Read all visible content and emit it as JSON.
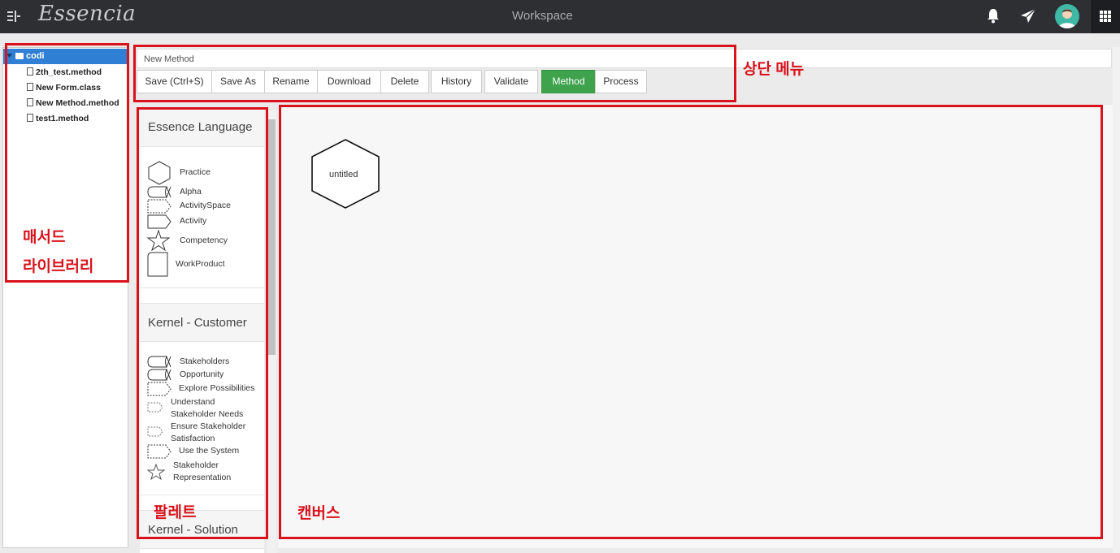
{
  "header": {
    "brand": "Essencia",
    "title": "Workspace",
    "icons": [
      "menu-toggle-icon",
      "bell-icon",
      "send-icon",
      "user-avatar",
      "apps-grid-icon"
    ]
  },
  "library": {
    "root": "codi",
    "files": [
      "2th_test.method",
      "New Form.class",
      "New Method.method",
      "test1.method"
    ]
  },
  "method_name": "New Method",
  "toolbar": {
    "buttons": [
      {
        "label": "Save (Ctrl+S)",
        "active": false
      },
      {
        "label": "Save As",
        "active": false
      },
      {
        "label": "Rename",
        "active": false
      },
      {
        "label": "Download",
        "active": false
      },
      {
        "label": "Delete",
        "active": false
      },
      {
        "label": "History",
        "active": false
      },
      {
        "label": "Validate",
        "active": false
      },
      {
        "label": "Method",
        "active": true
      },
      {
        "label": "Process",
        "active": false
      }
    ]
  },
  "palette": {
    "sections": [
      {
        "title": "Essence Language",
        "items": [
          "Practice",
          "Alpha",
          "ActivitySpace",
          "Activity",
          "Competency",
          "WorkProduct"
        ]
      },
      {
        "title": "Kernel - Customer",
        "items": [
          "Stakeholders",
          "Opportunity",
          "Explore Possibilities",
          "Understand Stakeholder Needs",
          "Ensure Stakeholder Satisfaction",
          "Use the System",
          "Stakeholder Representation"
        ],
        "split_labels": {
          "Understand Stakeholder Needs": [
            "Understand",
            "Stakeholder Needs"
          ],
          "Ensure Stakeholder Satisfaction": [
            "Ensure Stakeholder",
            "Satisfaction"
          ],
          "Stakeholder Representation": [
            "Stakeholder",
            "Representation"
          ]
        }
      },
      {
        "title": "Kernel - Solution",
        "items": []
      }
    ]
  },
  "canvas": {
    "node_label": "untitled"
  },
  "annotations": {
    "top_menu": "상단 메뉴",
    "library_line1": "매서드",
    "library_line2": "라이브러리",
    "palette": "팔레트",
    "canvas": "캔버스"
  },
  "colors": {
    "topbar": "#2d2f33",
    "selection": "#2f7fd4",
    "active_button": "#3fa34d",
    "annotation": "#d9121c"
  }
}
